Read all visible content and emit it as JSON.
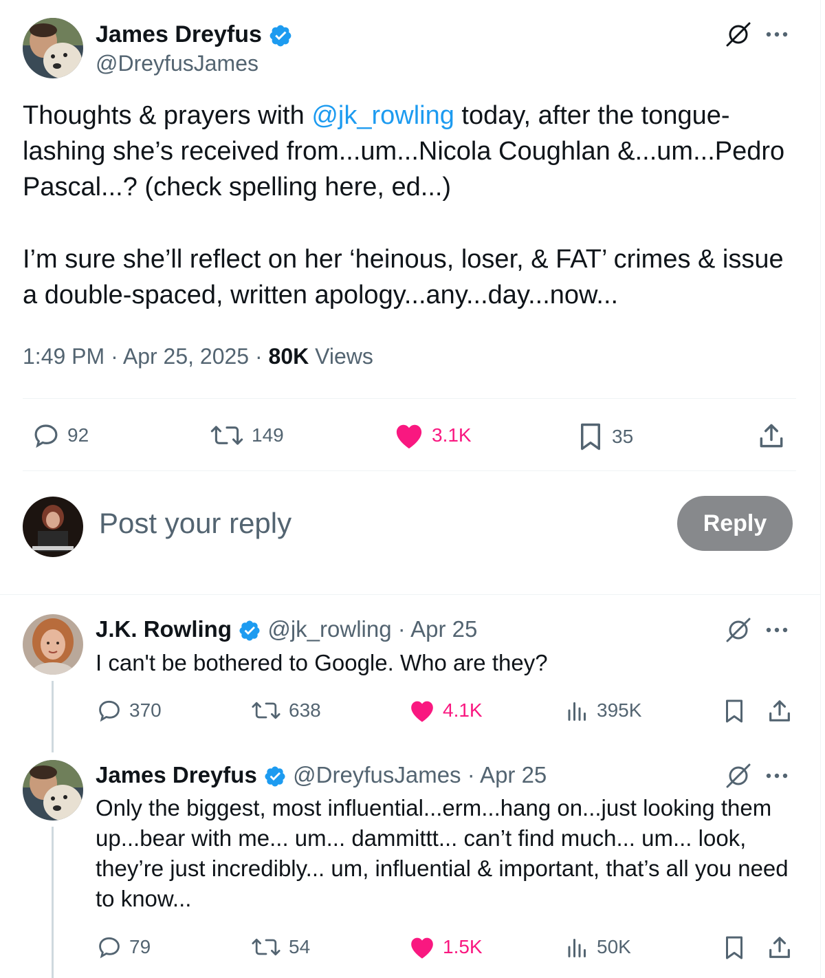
{
  "main_tweet": {
    "author": {
      "name": "James Dreyfus",
      "handle": "@DreyfusJames"
    },
    "text_before_mention": "Thoughts & prayers with ",
    "mention": "@jk_rowling",
    "text_after_mention": " today, after the tongue-lashing she’s received from...um...Nicola Coughlan &...um...Pedro Pascal...? (check spelling here, ed...)",
    "text_paragraph2": "I’m sure she’ll reflect on her ‘heinous, loser, & FAT’ crimes & issue a double-spaced, written apology...any...day...now...",
    "time": "1:49 PM · Apr 25, 2025 · ",
    "views_count": "80K",
    "views_label": " Views",
    "stats": {
      "replies": "92",
      "reposts": "149",
      "likes": "3.1K",
      "bookmarks": "35"
    }
  },
  "composer": {
    "placeholder": "Post your reply",
    "button": "Reply"
  },
  "replies": [
    {
      "name": "J.K. Rowling",
      "handle": "@jk_rowling",
      "date": "· Apr 25",
      "text": "I can't be bothered to Google. Who are they?",
      "stats": {
        "replies": "370",
        "reposts": "638",
        "likes": "4.1K",
        "views": "395K"
      }
    },
    {
      "name": "James Dreyfus",
      "handle": "@DreyfusJames",
      "date": "· Apr 25",
      "text": "Only the biggest, most influential...erm...hang on...just looking them up...bear with me... um... dammittt... can’t find much... um... look, they’re just incredibly... um, influential & important, that’s all you need to know...",
      "stats": {
        "replies": "79",
        "reposts": "54",
        "likes": "1.5K",
        "views": "50K"
      }
    }
  ],
  "colors": {
    "link": "#1d9bf0",
    "like": "#f91880",
    "muted": "#536471",
    "verified": "#1d9bf0",
    "reply_button": "#87898c"
  },
  "icons": [
    "verified-badge-icon",
    "grok-icon",
    "more-icon",
    "reply-icon",
    "repost-icon",
    "heart-icon",
    "bookmark-icon",
    "share-icon",
    "views-icon"
  ]
}
